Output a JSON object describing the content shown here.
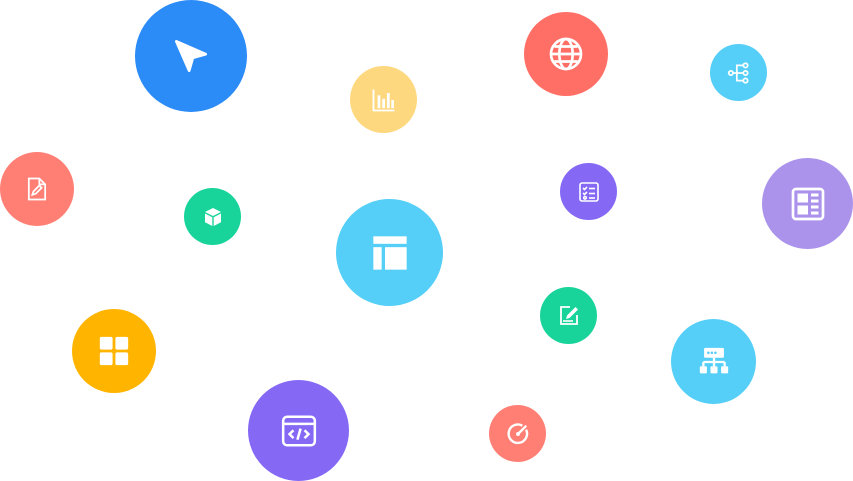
{
  "icons": [
    {
      "name": "cursor-pointer-icon",
      "color": "#2B8BF7"
    },
    {
      "name": "bar-chart-icon",
      "color": "#FDD87E"
    },
    {
      "name": "globe-icon",
      "color": "#FF6F66"
    },
    {
      "name": "hierarchy-tree-icon",
      "color": "#55CFF7"
    },
    {
      "name": "edit-document-icon",
      "color": "#FF7F75"
    },
    {
      "name": "cube-icon",
      "color": "#19D49A"
    },
    {
      "name": "layout-template-icon",
      "color": "#55CFF7"
    },
    {
      "name": "checklist-icon",
      "color": "#8569F5"
    },
    {
      "name": "dashboard-layout-icon",
      "color": "#AB93EC"
    },
    {
      "name": "grid-apps-icon",
      "color": "#FFB400"
    },
    {
      "name": "pencil-square-icon",
      "color": "#19D49A"
    },
    {
      "name": "network-server-icon",
      "color": "#55CFF7"
    },
    {
      "name": "code-window-icon",
      "color": "#8569F5"
    },
    {
      "name": "target-gauge-icon",
      "color": "#FF7F75"
    }
  ]
}
